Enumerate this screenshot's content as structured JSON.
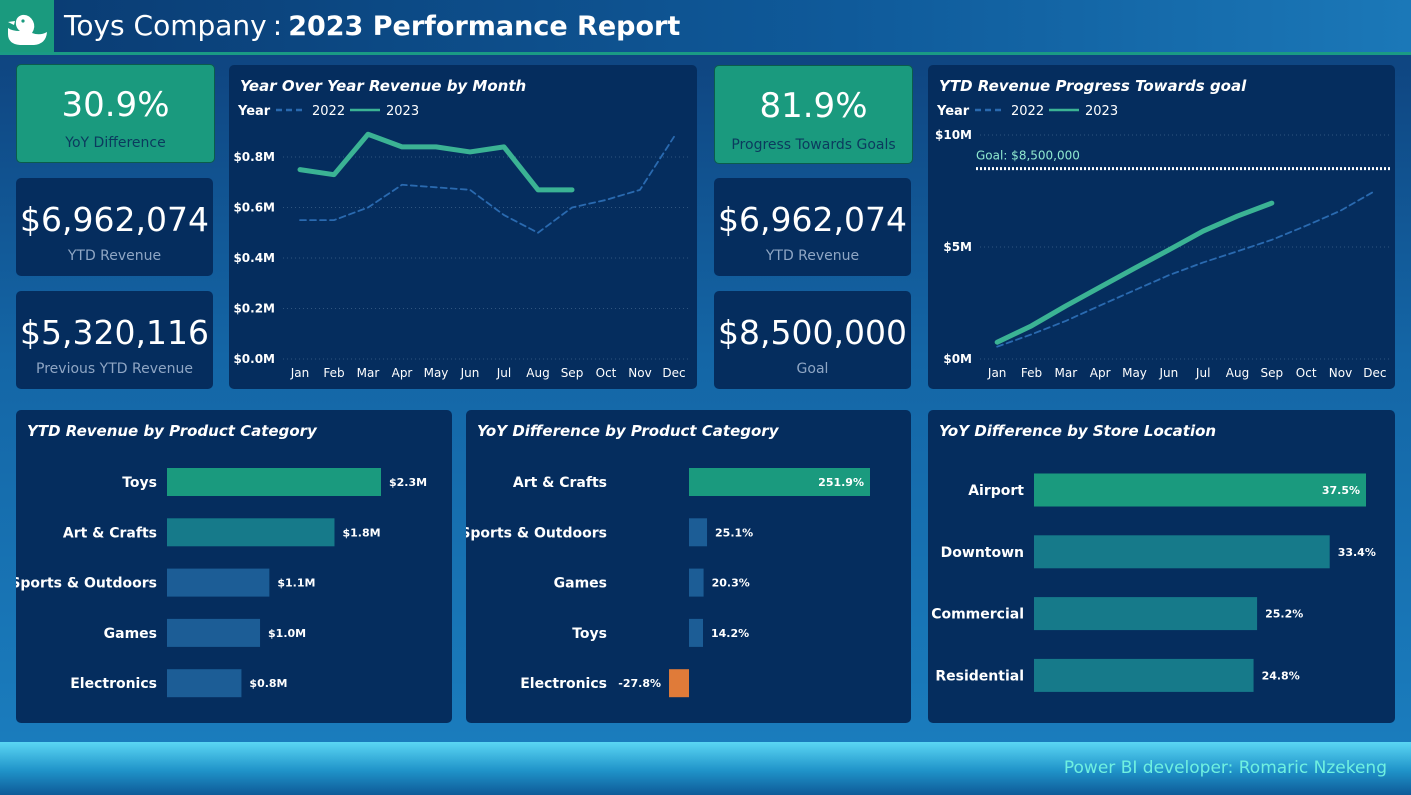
{
  "header": {
    "company": "Toys Company",
    "separator": ":",
    "report": "2023 Performance Report"
  },
  "kpis_left": [
    {
      "value": "30.9%",
      "label": "YoY Difference"
    },
    {
      "value": "$6,962,074",
      "label": "YTD Revenue"
    },
    {
      "value": "$5,320,116",
      "label": "Previous YTD Revenue"
    }
  ],
  "kpis_mid": [
    {
      "value": "81.9%",
      "label": "Progress Towards Goals"
    },
    {
      "value": "$6,962,074",
      "label": "YTD Revenue"
    },
    {
      "value": "$8,500,000",
      "label": "Goal"
    }
  ],
  "colors": {
    "s2022": "#2a6ab0",
    "s2023": "#3bb394",
    "bar_green": "#1a9a7e",
    "bar_teal": "#167a8a",
    "bar_blue": "#1c5d96",
    "neg": "#e07b39"
  },
  "footer": {
    "text": "Power BI developer: Romaric Nzekeng"
  },
  "chart_data": [
    {
      "id": "yoy-month",
      "type": "line",
      "title": "Year Over Year Revenue by Month",
      "legend_title": "Year",
      "legend_placement": "top-left",
      "categories": [
        "Jan",
        "Feb",
        "Mar",
        "Apr",
        "May",
        "Jun",
        "Jul",
        "Aug",
        "Sep",
        "Oct",
        "Nov",
        "Dec"
      ],
      "series": [
        {
          "name": "2022",
          "values": [
            0.55,
            0.55,
            0.6,
            0.69,
            0.68,
            0.67,
            0.57,
            0.5,
            0.6,
            0.63,
            0.67,
            0.88
          ],
          "style": "dashed"
        },
        {
          "name": "2023",
          "values": [
            0.75,
            0.73,
            0.89,
            0.84,
            0.84,
            0.82,
            0.84,
            0.67,
            0.67,
            null,
            null,
            null
          ],
          "style": "solid"
        }
      ],
      "ylim": [
        0,
        0.8
      ],
      "yticks": [
        "$0.0M",
        "$0.2M",
        "$0.4M",
        "$0.6M",
        "$0.8M"
      ],
      "ytick_values": [
        0,
        0.2,
        0.4,
        0.6,
        0.8
      ],
      "grid": true
    },
    {
      "id": "ytd-goal",
      "type": "line",
      "title": "YTD Revenue Progress Towards goal",
      "legend_title": "Year",
      "legend_placement": "top-left",
      "categories": [
        "Jan",
        "Feb",
        "Mar",
        "Apr",
        "May",
        "Jun",
        "Jul",
        "Aug",
        "Sep",
        "Oct",
        "Nov",
        "Dec"
      ],
      "series": [
        {
          "name": "2022",
          "values": [
            0.55,
            1.1,
            1.7,
            2.39,
            3.07,
            3.74,
            4.31,
            4.81,
            5.32,
            5.95,
            6.62,
            7.5
          ],
          "style": "dashed"
        },
        {
          "name": "2023",
          "values": [
            0.75,
            1.48,
            2.37,
            3.21,
            4.05,
            4.87,
            5.71,
            6.38,
            6.96,
            null,
            null,
            null
          ],
          "style": "solid"
        }
      ],
      "goal": {
        "label": "Goal: $8,500,000",
        "value": 8.5
      },
      "ylim": [
        0,
        10
      ],
      "yticks": [
        "$0M",
        "$5M",
        "$10M"
      ],
      "ytick_values": [
        0,
        5,
        10
      ],
      "grid": true
    },
    {
      "id": "ytd-product",
      "type": "bar",
      "orientation": "horizontal",
      "title": "YTD Revenue by Product Category",
      "categories": [
        "Toys",
        "Art & Crafts",
        "Sports & Outdoors",
        "Games",
        "Electronics"
      ],
      "values": [
        2.3,
        1.8,
        1.1,
        1.0,
        0.8
      ],
      "labels": [
        "$2.3M",
        "$1.8M",
        "$1.1M",
        "$1.0M",
        "$0.8M"
      ]
    },
    {
      "id": "yoy-product",
      "type": "bar",
      "orientation": "horizontal",
      "title": "YoY Difference by Product Category",
      "categories": [
        "Art & Crafts",
        "Sports & Outdoors",
        "Games",
        "Toys",
        "Electronics"
      ],
      "values": [
        251.9,
        25.1,
        20.3,
        14.2,
        -27.8
      ],
      "labels": [
        "251.9%",
        "25.1%",
        "20.3%",
        "14.2%",
        "-27.8%"
      ]
    },
    {
      "id": "yoy-store",
      "type": "bar",
      "orientation": "horizontal",
      "title": "YoY Difference by Store Location",
      "categories": [
        "Airport",
        "Downtown",
        "Commercial",
        "Residential"
      ],
      "values": [
        37.5,
        33.4,
        25.2,
        24.8
      ],
      "labels": [
        "37.5%",
        "33.4%",
        "25.2%",
        "24.8%"
      ]
    }
  ]
}
